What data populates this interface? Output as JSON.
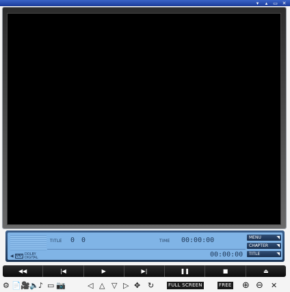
{
  "window": {
    "controls": [
      "▾",
      "▴",
      "▭",
      "✕"
    ]
  },
  "info": {
    "title_label": "TITLE",
    "title_value": "0",
    "chapter_value": "0",
    "time_label": "TIME",
    "time_value": "00:00:00",
    "elapsed_value": "00:00:00",
    "dolby_line1": "DOLBY",
    "dolby_line2": "DIGITAL",
    "dolby_box": "DD"
  },
  "side_buttons": {
    "menu": "MENU",
    "chapter": "CHAPTER",
    "title": "TITLE"
  },
  "transport": {
    "rewind": "◀◀",
    "prev": "|◀",
    "play": "▶",
    "next": "▶|",
    "pause": "❚❚",
    "stop": "■",
    "eject": "⏏"
  },
  "toolbar": {
    "fullscreen": "FULL SCREEN",
    "free": "FREE",
    "left": "◁",
    "up": "△",
    "down": "▽",
    "right": "▷",
    "close": "✕"
  }
}
